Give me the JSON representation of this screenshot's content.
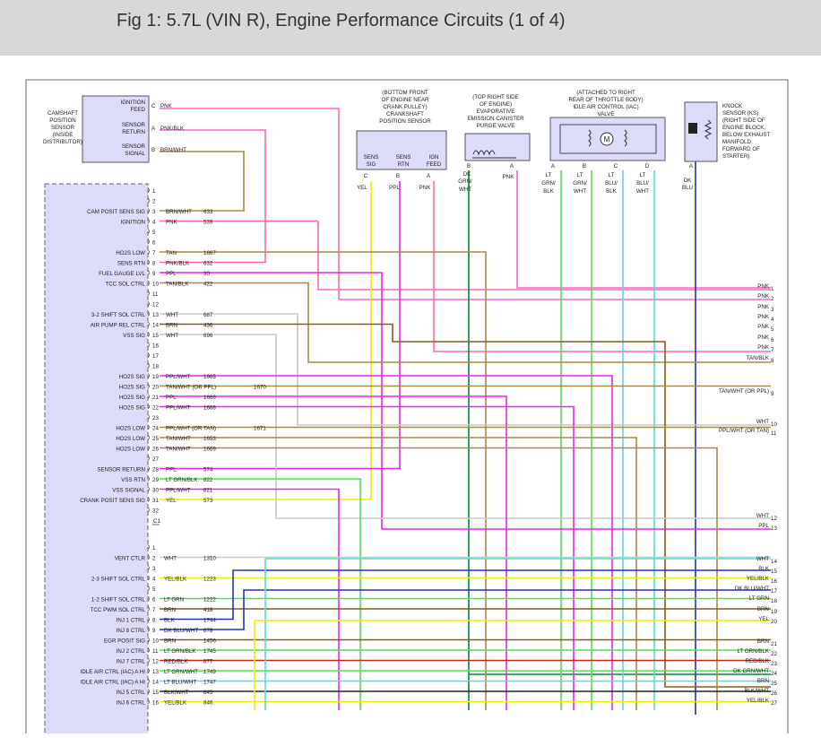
{
  "page": {
    "title": "Fig 1: 5.7L (VIN R), Engine Performance Circuits (1 of 4)"
  },
  "colors": {
    "PNK": "#ff66bb",
    "BRN": "#8a5a1a",
    "TAN": "#a88a4a",
    "PPL": "#ee22ee",
    "WHT": "#c8c8c8",
    "YEL": "#eeee00",
    "LTGRN": "#55dd55",
    "DKGRN": "#008833",
    "LTBLU": "#55dddd",
    "DKBLU": "#2233bb",
    "BLK": "#222222",
    "RED": "#cc2222",
    "pcm_fill": "#dcdcf8",
    "box_fill": "#dcdcf8",
    "outline": "#555555"
  },
  "components": {
    "cmp": {
      "lines": [
        "CAMSHAFT",
        "POSITION",
        "SENSOR",
        "(INSIDE",
        "DISTRIBUTOR)"
      ],
      "pins": [
        [
          "IGNITION",
          "FEED",
          "C",
          "PNK"
        ],
        [
          "SENSOR",
          "RETURN",
          "A",
          "PNK/BLK"
        ],
        [
          "SENSOR",
          "SIGNAL",
          "B",
          "BRN/WHT"
        ]
      ]
    },
    "ckp": {
      "lines": [
        "(BOTTOM FRONT",
        "OF ENGINE NEAR",
        "CRANK PULLEY)",
        "CRANKSHAFT",
        "POSITION SENSOR"
      ],
      "pins": [
        [
          "SENS",
          "SIG",
          "C",
          "YEL"
        ],
        [
          "SENS",
          "RTN",
          "B",
          "PPL"
        ],
        [
          "IGN",
          "FEED",
          "A",
          "PNK"
        ]
      ]
    },
    "evap": {
      "lines": [
        "(TOP RIGHT SIDE",
        "OF ENGINE)",
        "EVAPORATIVE",
        "EMISSION CANISTER",
        "PURGE VALVE"
      ],
      "pins": [
        [
          "B",
          "DK",
          "GRN/",
          "WHT"
        ],
        [
          "A",
          "PNK",
          "",
          ""
        ]
      ]
    },
    "iac": {
      "lines": [
        "(ATTACHED TO RIGHT",
        "REAR OF THROTTLE BODY)",
        "IDLE AIR CONTROL (IAC)",
        "VALVE"
      ],
      "motor": "M",
      "pins": [
        [
          "A",
          "LT",
          "GRN/",
          "BLK"
        ],
        [
          "B",
          "LT",
          "GRN/",
          "WHT"
        ],
        [
          "C",
          "LT",
          "BLU/",
          "BLK"
        ],
        [
          "D",
          "LT",
          "BLU/",
          "WHT"
        ]
      ]
    },
    "ks": {
      "lines": [
        "KNOCK",
        "SENSOR (KS)",
        "(RIGHT SIDE OF",
        "ENGINE BLOCK,",
        "BELOW EXHAUST",
        "MANIFOLD,",
        "FORWARD OF",
        "STARTER)"
      ],
      "pins": [
        [
          "A",
          "DK",
          "BLU",
          ""
        ]
      ]
    }
  },
  "connector1": [
    [
      "1",
      "",
      "",
      ""
    ],
    [
      "2",
      "",
      "",
      ""
    ],
    [
      "3",
      "BRN/WHT",
      "633",
      "CAM POSIT SENS SIG"
    ],
    [
      "4",
      "PNK",
      "539",
      "IGNITION"
    ],
    [
      "5",
      "",
      "",
      ""
    ],
    [
      "6",
      "",
      "",
      ""
    ],
    [
      "7",
      "TAN",
      "1667",
      "HO2S LOW"
    ],
    [
      "8",
      "PNK/BLK",
      "632",
      "SENS RTN"
    ],
    [
      "9",
      "PPL",
      "30",
      "FUEL GAUGE LVL"
    ],
    [
      "10",
      "TAN/BLK",
      "422",
      "TCC SOL CTRL"
    ],
    [
      "11",
      "",
      "",
      ""
    ],
    [
      "12",
      "",
      "",
      ""
    ],
    [
      "13",
      "WHT",
      "687",
      "3-2 SHIFT SOL CTRL"
    ],
    [
      "14",
      "BRN",
      "436",
      "AIR PUMP REL CTRL"
    ],
    [
      "15",
      "WHT",
      "696",
      "VSS SIG"
    ],
    [
      "16",
      "",
      "",
      ""
    ],
    [
      "17",
      "",
      "",
      ""
    ],
    [
      "18",
      "",
      "",
      ""
    ],
    [
      "19",
      "PPL/WHT",
      "1665",
      "HO2S SIG"
    ],
    [
      "20",
      "TAN/WHT (OR PPL)",
      "1670",
      "HO2S SIG"
    ],
    [
      "21",
      "PPL",
      "1666",
      "HO2S SIG"
    ],
    [
      "22",
      "PPL/WHT",
      "1668",
      "HO2S SIG"
    ],
    [
      "23",
      "",
      "",
      ""
    ],
    [
      "24",
      "PPL/WHT (OR TAN)",
      "1671",
      "HO2S LOW"
    ],
    [
      "25",
      "TAN/WHT",
      "1653",
      "HO2S LOW"
    ],
    [
      "26",
      "TAN/WHT",
      "1669",
      "HO2S LOW"
    ],
    [
      "27",
      "",
      "",
      ""
    ],
    [
      "28",
      "PPL",
      "574",
      "SENSOR RETURN"
    ],
    [
      "29",
      "LT GRN/BLK",
      "822",
      "VSS RTN"
    ],
    [
      "30",
      "PPL/WHT",
      "821",
      "VSS SIGNAL"
    ],
    [
      "31",
      "YEL",
      "573",
      "CRANK POSIT SENS SIG"
    ],
    [
      "32",
      "",
      "",
      ""
    ]
  ],
  "connector1_id": "C1",
  "connector2": [
    [
      "1",
      "",
      "",
      ""
    ],
    [
      "2",
      "WHT",
      "1310",
      "VENT CTLR"
    ],
    [
      "3",
      "",
      "",
      ""
    ],
    [
      "4",
      "YEL/BLK",
      "1223",
      "2-3 SHIFT SOL CTRL"
    ],
    [
      "5",
      "",
      "",
      ""
    ],
    [
      "6",
      "LT GRN",
      "1222",
      "1-2 SHIFT SOL CTRL"
    ],
    [
      "7",
      "BRN",
      "418",
      "TCC PWM SOL CTRL"
    ],
    [
      "8",
      "BLK",
      "1744",
      "INJ 1 CTRL"
    ],
    [
      "9",
      "DK BLU/WHT",
      "878",
      "INJ 8 CTRL"
    ],
    [
      "10",
      "BRN",
      "1456",
      "EGR POSIT SIG"
    ],
    [
      "11",
      "LT GRN/BLK",
      "1745",
      "INJ 2 CTRL"
    ],
    [
      "12",
      "RED/BLK",
      "877",
      "INJ 7 CTRL"
    ],
    [
      "13",
      "LT GRN/WHT",
      "1749",
      "IDLE AIR CTRL (IAC) A HI"
    ],
    [
      "14",
      "LT BLU/WHT",
      "1747",
      "IDLE AIR CTRL (IAC) A HI"
    ],
    [
      "15",
      "BLK/WHT",
      "845",
      "INJ 5 CTRL"
    ],
    [
      "16",
      "YEL/BLK",
      "846",
      "INJ 6 CTRL"
    ]
  ],
  "right_labels": [
    [
      "PNK",
      "1"
    ],
    [
      "PNK",
      "2"
    ],
    [
      "PNK",
      "3"
    ],
    [
      "PNK",
      "4"
    ],
    [
      "PNK",
      "5"
    ],
    [
      "PNK",
      "6"
    ],
    [
      "PNK",
      "7"
    ],
    [
      "TAN/BLK",
      "8"
    ],
    [
      "TAN/WHT (OR PPL)",
      "9"
    ],
    [
      "WHT",
      "10"
    ],
    [
      "PPL/WHT (OR TAN)",
      "11"
    ],
    [
      "WHT",
      "12"
    ],
    [
      "PPL",
      "13"
    ],
    [
      "WHT",
      "14"
    ],
    [
      "BLK",
      "15"
    ],
    [
      "YEL/BLK",
      "16"
    ],
    [
      "DK BLU/WHT",
      "17"
    ],
    [
      "LT GRN",
      "18"
    ],
    [
      "BRN",
      "19"
    ],
    [
      "YEL",
      "20"
    ],
    [
      "BRN",
      "21"
    ],
    [
      "LT GRN/BLK",
      "22"
    ],
    [
      "RED/BLK",
      "23"
    ],
    [
      "DK GRN/WHT",
      "24"
    ],
    [
      "BRN",
      "25"
    ],
    [
      "BLK/WHT",
      "26"
    ],
    [
      "YEL/BLK",
      "27"
    ]
  ]
}
